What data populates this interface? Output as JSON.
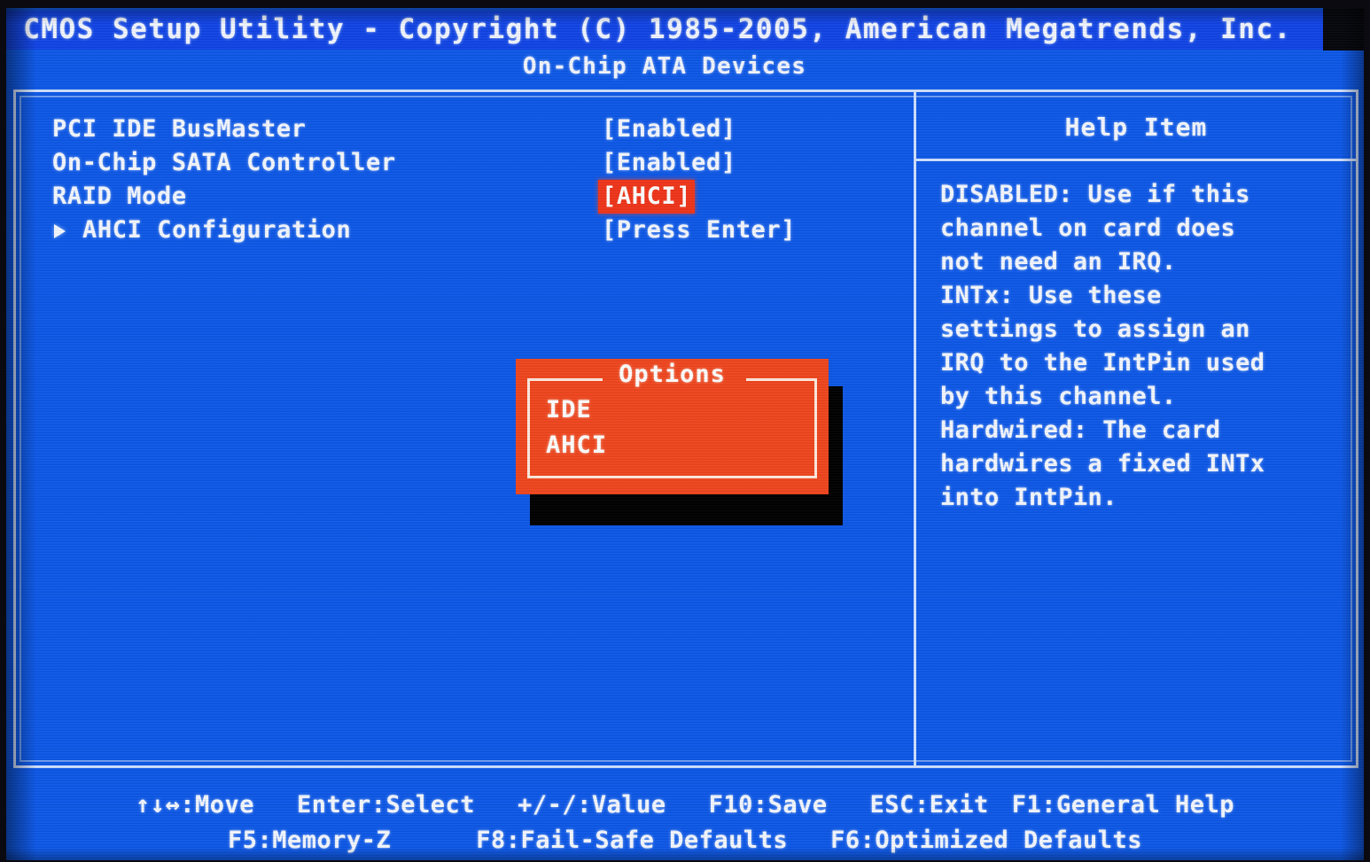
{
  "screen": {
    "background_color": "#0d58e8",
    "text_color": "#f4f8ff",
    "highlight_color": "#f0461e",
    "shadow_color": "#000000",
    "border_color": "#cfe0ff"
  },
  "header": {
    "title": "CMOS Setup Utility - Copyright (C) 1985-2005, American Megatrends, Inc.",
    "subtitle": "On-Chip ATA Devices"
  },
  "settings": {
    "rows": [
      {
        "label": "PCI IDE BusMaster",
        "value": "[Enabled]",
        "selected": false,
        "submenu": false
      },
      {
        "label": "On-Chip SATA Controller",
        "value": "[Enabled]",
        "selected": false,
        "submenu": false
      },
      {
        "label": "RAID Mode",
        "value": "[AHCI]",
        "selected": true,
        "submenu": false
      },
      {
        "label": "AHCI Configuration",
        "value": "[Press Enter]",
        "selected": false,
        "submenu": true
      }
    ]
  },
  "help": {
    "title": "Help Item",
    "lines": [
      "DISABLED: Use if this",
      "channel on card does",
      "not need an IRQ.",
      "INTx: Use these",
      "settings to assign an",
      "IRQ to the IntPin used",
      "by this channel.",
      "Hardwired: The card",
      "hardwires a fixed INTx",
      "into IntPin."
    ]
  },
  "popup": {
    "title": "Options",
    "options": [
      {
        "label": "IDE"
      },
      {
        "label": "AHCI"
      }
    ]
  },
  "footer": {
    "row1": [
      "↑↓↔:Move",
      "Enter:Select",
      "+/-/:Value",
      "F10:Save",
      "ESC:Exit",
      "F1:General Help"
    ],
    "row2": [
      "F5:Memory-Z",
      "F8:Fail-Safe Defaults",
      "F6:Optimized Defaults"
    ]
  }
}
